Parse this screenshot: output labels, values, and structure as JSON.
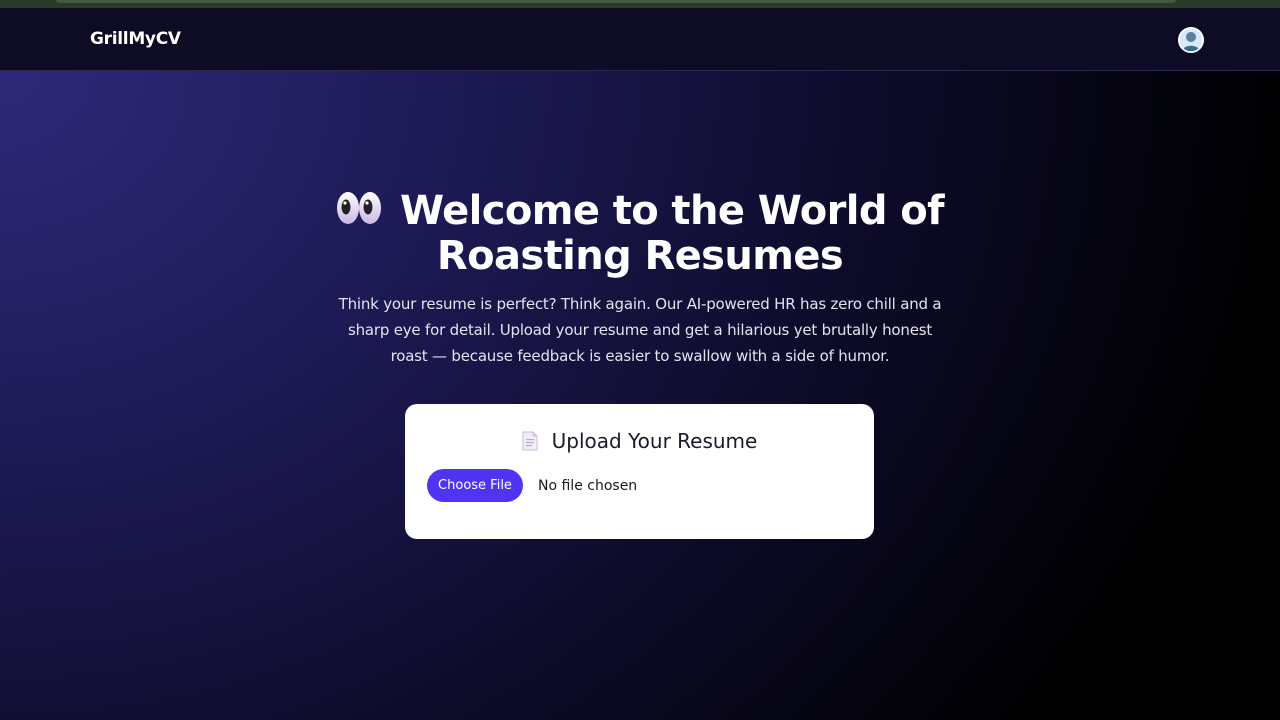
{
  "navbar": {
    "brand": "GrillMyCV",
    "avatar_icon": "user-avatar-icon"
  },
  "hero": {
    "title_icon": "eyes-emoji",
    "title": "Welcome to the World of Roasting Resumes",
    "description": "Think your resume is perfect? Think again. Our AI-powered HR has zero chill and a sharp eye for detail. Upload your resume and get a hilarious yet brutally honest roast — because feedback is easier to swallow with a side of humor."
  },
  "upload": {
    "icon": "document-emoji",
    "heading": "Upload Your Resume",
    "button_label": "Choose File",
    "file_status": "No file chosen"
  },
  "colors": {
    "accent": "#4f35f3",
    "navbar_bg": "#0e0c24",
    "gradient_start": "#2e2a7a",
    "gradient_end": "#000000"
  }
}
